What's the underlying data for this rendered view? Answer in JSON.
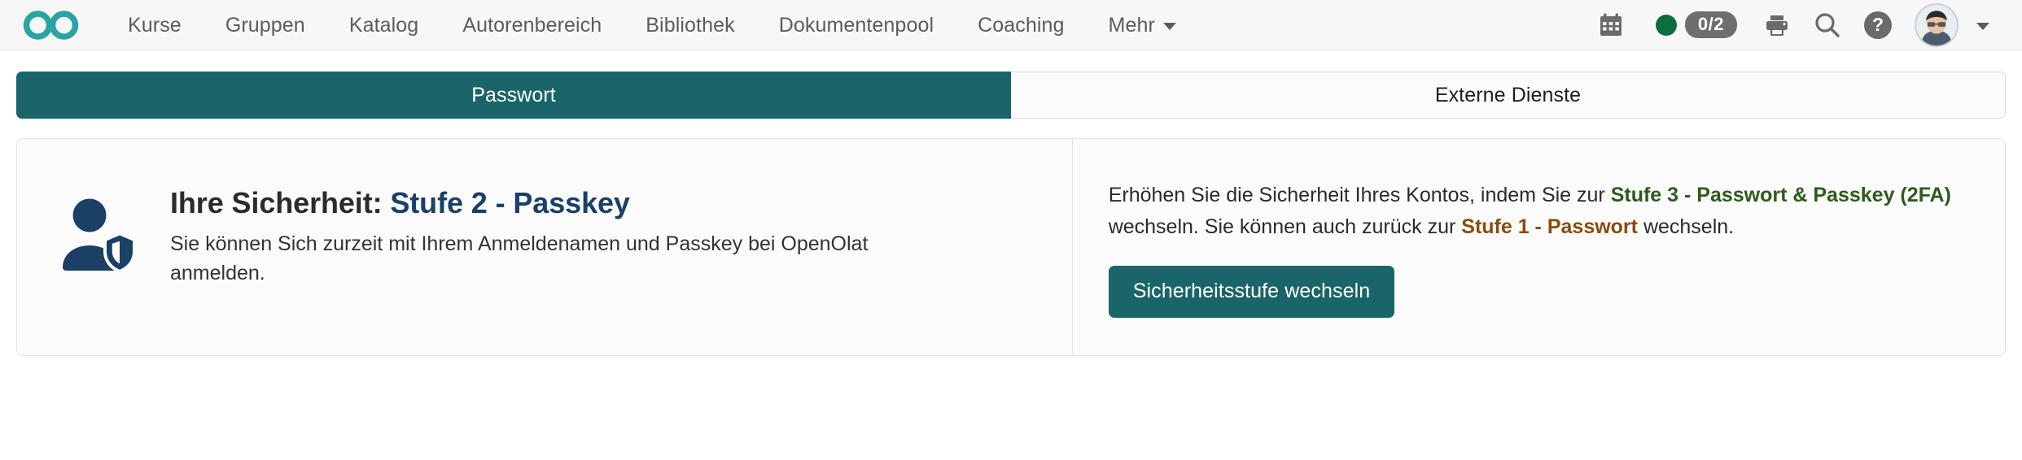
{
  "header": {
    "logo_name": "openolat-infinity-logo",
    "logo_color": "#2aa3a3",
    "nav_items": [
      {
        "label": "Kurse",
        "name": "nav-item-kurse"
      },
      {
        "label": "Gruppen",
        "name": "nav-item-gruppen"
      },
      {
        "label": "Katalog",
        "name": "nav-item-katalog"
      },
      {
        "label": "Autorenbereich",
        "name": "nav-item-autorenbereich"
      },
      {
        "label": "Bibliothek",
        "name": "nav-item-bibliothek"
      },
      {
        "label": "Dokumentenpool",
        "name": "nav-item-dokumentenpool"
      },
      {
        "label": "Coaching",
        "name": "nav-item-coaching"
      },
      {
        "label": "Mehr",
        "name": "nav-item-mehr",
        "has_caret": true
      }
    ],
    "tools": {
      "calendar_icon": "calendar-icon",
      "status_dot": {
        "name": "status-dot",
        "color": "#0b6e3c"
      },
      "count_badge": "0/2",
      "print_icon": "printer-icon",
      "search_icon": "search-icon",
      "help_icon": "?",
      "avatar": "user-avatar",
      "avatar_caret": "chevron-down-icon"
    }
  },
  "tabs": [
    {
      "label": "Passwort",
      "active": true
    },
    {
      "label": "Externe Dienste",
      "active": false
    }
  ],
  "panel": {
    "left": {
      "icon_name": "user-shield-icon",
      "icon_color": "#1b4066",
      "heading_prefix": "Ihre Sicherheit: ",
      "heading_level": "Stufe 2 - Passkey",
      "description": "Sie können Sich zurzeit mit Ihrem Anmeldenamen und Passkey bei OpenOlat anmelden."
    },
    "right": {
      "text_part1": "Erhöhen Sie die Sicherheit Ihres Kontos, indem Sie zur ",
      "level3_link": "Stufe 3 - Passwort & Passkey (2FA)",
      "text_part2": " wechseln. Sie können auch zurück zur ",
      "level1_link": "Stufe 1 - Passwort",
      "text_part3": " wechseln.",
      "button_label": "Sicherheitsstufe wechseln"
    }
  },
  "colors": {
    "accent_teal": "#1a6569",
    "navy": "#1b4066",
    "green": "#2f5a1e",
    "brown": "#8a4b10"
  }
}
